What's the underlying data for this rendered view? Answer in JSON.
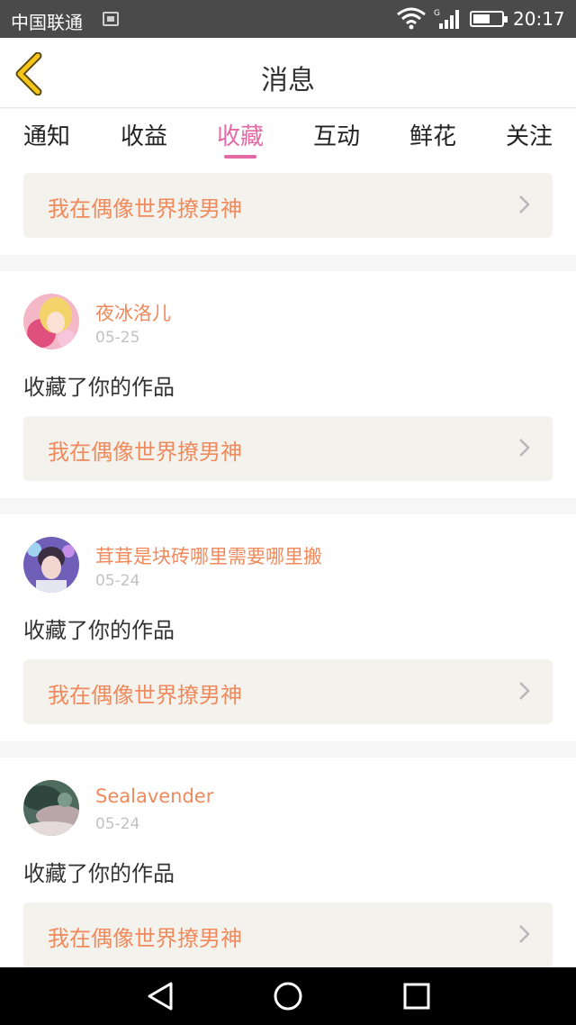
{
  "status_bar": {
    "carrier": "中国联通",
    "time": "20:17",
    "network_type": "G",
    "battery_level": 0.6,
    "icons": [
      "image-notification-icon",
      "wifi-icon",
      "signal-icon",
      "battery-icon"
    ]
  },
  "header": {
    "title": "消息",
    "back_icon": "chevron-left-icon",
    "accent_color": "#f5c518"
  },
  "tabs": [
    {
      "label": "通知",
      "active": false
    },
    {
      "label": "收益",
      "active": false
    },
    {
      "label": "收藏",
      "active": true
    },
    {
      "label": "互动",
      "active": false
    },
    {
      "label": "鲜花",
      "active": false
    },
    {
      "label": "关注",
      "active": false
    }
  ],
  "colors": {
    "active_tab": "#e46aa5",
    "name_and_work": "#f08a5d",
    "work_bg": "#f3f2ed"
  },
  "messages": [
    {
      "work_title": "我在偶像世界撩男神"
    },
    {
      "user": "夜冰洛儿",
      "date": "05-25",
      "action": "收藏了你的作品",
      "work_title": "我在偶像世界撩男神"
    },
    {
      "user": "茸茸是块砖哪里需要哪里搬",
      "date": "05-24",
      "action": "收藏了你的作品",
      "work_title": "我在偶像世界撩男神"
    },
    {
      "user": "Sealavender",
      "date": "05-24",
      "action": "收藏了你的作品",
      "work_title": "我在偶像世界撩男神"
    }
  ],
  "nav_bar": {
    "icons": [
      "back-triangle-icon",
      "home-circle-icon",
      "recents-square-icon"
    ]
  }
}
